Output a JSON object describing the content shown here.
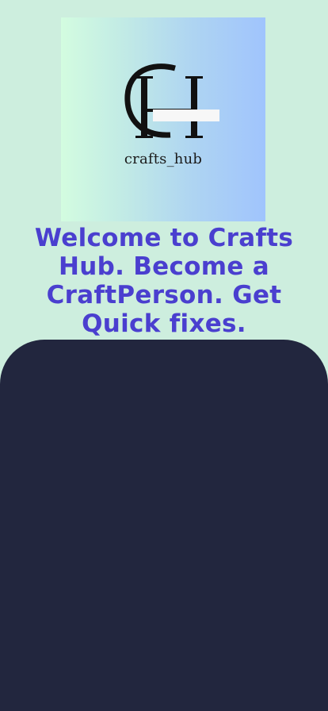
{
  "logo": {
    "monogram": "CH",
    "text": "crafts_hub"
  },
  "headline": "Welcome to Crafts Hub. Become a CraftPerson. Get Quick fixes.",
  "colors": {
    "background": "#cdeede",
    "headline": "#4a3fcf",
    "panel": "#22263e",
    "logo_gradient_start": "#d3fce0",
    "logo_gradient_end": "#a0c4fd"
  }
}
